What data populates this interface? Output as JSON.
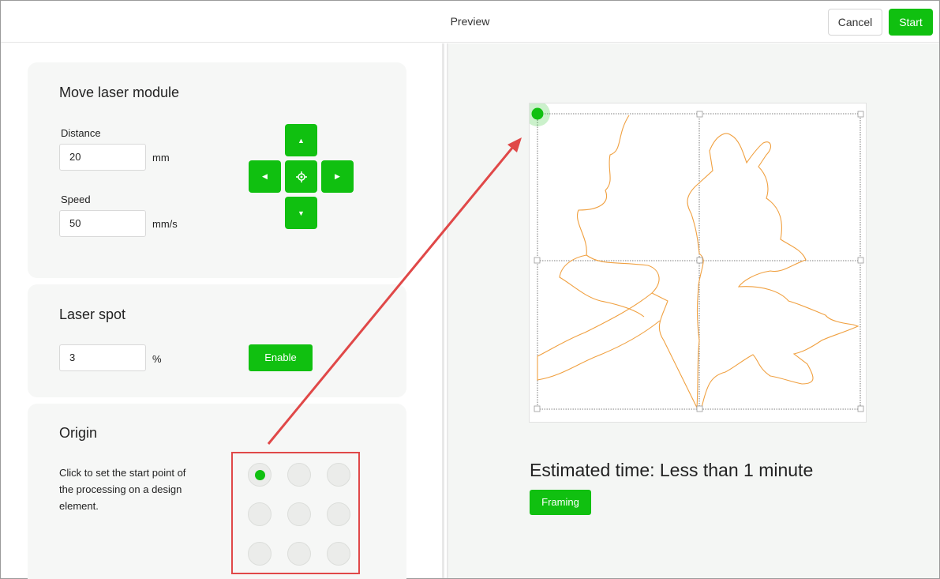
{
  "header": {
    "title": "Preview",
    "cancel_label": "Cancel",
    "start_label": "Start"
  },
  "move_laser": {
    "title": "Move laser module",
    "distance_label": "Distance",
    "distance_value": "20",
    "distance_unit": "mm",
    "speed_label": "Speed",
    "speed_value": "50",
    "speed_unit": "mm/s",
    "dpad_icons": [
      "arrow-up-icon",
      "arrow-left-icon",
      "crosshair-icon",
      "arrow-right-icon",
      "arrow-down-icon"
    ]
  },
  "laser_spot": {
    "title": "Laser spot",
    "value": "3",
    "unit": "%",
    "enable_label": "Enable"
  },
  "origin": {
    "title": "Origin",
    "description": "Click to set the start point of the processing on a design element.",
    "selected_index": 0,
    "grid_size": 3
  },
  "preview": {
    "estimated_time": "Estimated time: Less than 1 minute",
    "framing_label": "Framing"
  },
  "colors": {
    "accent": "#10c010",
    "leaf_outline": "#f0a040",
    "annotation": "#e04848"
  }
}
